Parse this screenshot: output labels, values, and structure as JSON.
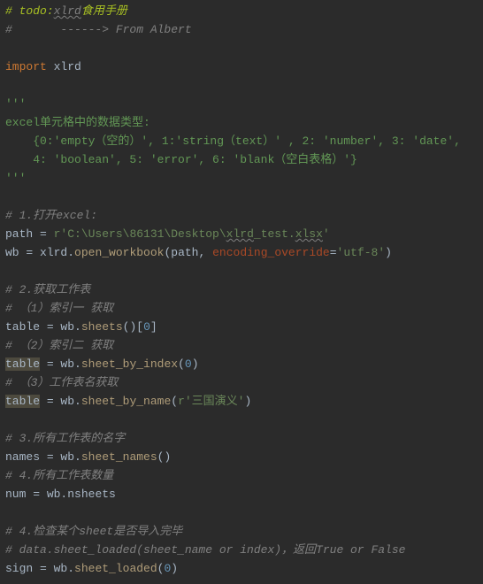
{
  "code": {
    "l1_hash": "# ",
    "l1_todo": "todo:",
    "l1_xlrd": "xlrd",
    "l1_rest": "食用手册",
    "l2": "#       ------> From Albert",
    "l3_import": "import ",
    "l3_mod": "xlrd",
    "l4_triple": "'''",
    "l5": "excel单元格中的数据类型:",
    "l6": "    {0:'empty（空的）', 1:'string（text）' , 2: 'number', 3: 'date',",
    "l7": "    4: 'boolean', 5: 'error', 6: 'blank（空白表格）'}",
    "l8_triple": "'''",
    "l9": "# 1.打开excel:",
    "l10_path": "path",
    "l10_eq": " = ",
    "l10_str1": "r'C:\\Users\\86131\\Desktop\\",
    "l10_str2": "xlrd",
    "l10_str3": "_test.",
    "l10_str4": "xlsx",
    "l10_str5": "'",
    "l11_wb": "wb",
    "l11_eq": " = ",
    "l11_mod": "xlrd",
    "l11_dot": ".",
    "l11_func": "open_workbook",
    "l11_paren_o": "(",
    "l11_arg": "path",
    "l11_comma": ", ",
    "l11_kw": "encoding_override",
    "l11_kwv": "=",
    "l11_str": "'utf-8'",
    "l11_paren_c": ")",
    "l12": "# 2.获取工作表",
    "l13": "# （1）索引一 获取",
    "l14_tbl": "table",
    "l14_eq": " = ",
    "l14_wb": "wb",
    "l14_dot": ".",
    "l14_fn": "sheets",
    "l14_call": "()[",
    "l14_idx": "0",
    "l14_close": "]",
    "l15": "# （2）索引二 获取",
    "l16_tbl": "table",
    "l16_eq": " = ",
    "l16_wb": "wb",
    "l16_dot": ".",
    "l16_fn": "sheet_by_index",
    "l16_po": "(",
    "l16_idx": "0",
    "l16_pc": ")",
    "l17": "# （3）工作表名获取",
    "l18_tbl": "table",
    "l18_eq": " = ",
    "l18_wb": "wb",
    "l18_dot": ".",
    "l18_fn": "sheet_by_name",
    "l18_po": "(",
    "l18_str": "r'三国演义'",
    "l18_pc": ")",
    "l19": "# 3.所有工作表的名字",
    "l20_names": "names",
    "l20_eq": " = ",
    "l20_wb": "wb",
    "l20_dot": ".",
    "l20_fn": "sheet_names",
    "l20_call": "()",
    "l21": "# 4.所有工作表数量",
    "l22_num": "num",
    "l22_eq": " = ",
    "l22_wb": "wb",
    "l22_dot": ".",
    "l22_attr": "nsheets",
    "l23": "# 4.检查某个sheet是否导入完毕",
    "l24": "# data.sheet_loaded(sheet_name or index)，返回True or False",
    "l25_sign": "sign",
    "l25_eq": " = ",
    "l25_wb": "wb",
    "l25_dot": ".",
    "l25_fn": "sheet_loaded",
    "l25_po": "(",
    "l25_idx": "0",
    "l25_pc": ")"
  }
}
